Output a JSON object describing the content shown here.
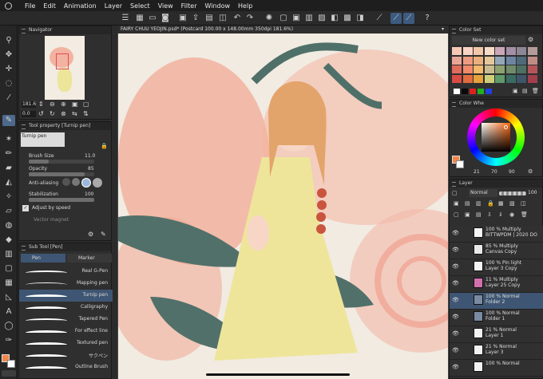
{
  "menu": [
    "File",
    "Edit",
    "Animation",
    "Layer",
    "Select",
    "View",
    "Filter",
    "Window",
    "Help"
  ],
  "document": {
    "tab": "FAIRY CHUU YEOJIN.psd* (Postcard 100.00 x 148.00mm 350dpi 181.6%)"
  },
  "navigator": {
    "title": "Navigator",
    "zoom": "181.6",
    "angle": "0.0"
  },
  "tool_property": {
    "title": "Tool property [Turnip pen]",
    "tool_name": "Turnip pen",
    "brush_size_label": "Brush Size",
    "brush_size": "11.0",
    "opacity_label": "Opacity",
    "opacity": "85",
    "aa_label": "Anti-aliasing",
    "stabilization_label": "Stabilization",
    "stabilization": "100",
    "adjust_label": "Adjust by speed",
    "vector_label": "Vector magnet"
  },
  "sub_tool": {
    "title": "Sub Tool [Pen]",
    "tabs": [
      "Pen",
      "Marker"
    ],
    "items": [
      "Real G-Pen",
      "Mapping pen",
      "Turnip pen",
      "Calligraphy",
      "Tapered Pen",
      "For effect line",
      "Textured pen",
      "サクペン",
      "Outline Brush"
    ]
  },
  "color_set": {
    "title": "Color Set",
    "dropdown": "New color set",
    "swatches": [
      "#f6c9b4",
      "#f8d4c4",
      "#f2c6a8",
      "#f6dcc8",
      "#c9a7b7",
      "#a48fa6",
      "#8c8696",
      "#b39c9a",
      "#e9a695",
      "#ed9b80",
      "#e9b07e",
      "#e6c79b",
      "#94a7b9",
      "#6d85a3",
      "#4f6a7b",
      "#c08d86",
      "#e26b5b",
      "#f08a6a",
      "#f4b86a",
      "#cbbb90",
      "#8ca16f",
      "#6f8c6a",
      "#4d7062",
      "#b6545b",
      "#d94b44",
      "#e16c3d",
      "#e7a23d",
      "#cfcf7a",
      "#5e9a6a",
      "#3a6c63",
      "#3f5569",
      "#a23f4c"
    ],
    "primaries": [
      "#ffffff",
      "#0a0a0a",
      "#e02020",
      "#20b020",
      "#2040e0"
    ]
  },
  "color_wheel": {
    "title": "Color Whe",
    "h": "21",
    "s": "70",
    "v": "90",
    "main": "#f0864a",
    "sub": "#ffffff"
  },
  "layer": {
    "title": "Layer",
    "blend": "Normal",
    "opacity": "100",
    "rows": [
      {
        "l1": "100 % Multiply",
        "l2": "BITTWPDM | 2020 DO",
        "thumb": "#f4f4f4",
        "sel": false
      },
      {
        "l1": "85 % Multiply",
        "l2": "Canvas Copy",
        "thumb": "#e9e9e9",
        "sel": false
      },
      {
        "l1": "100 % Pin light",
        "l2": "Layer 3 Copy",
        "thumb": "#f5f5f5",
        "sel": false
      },
      {
        "l1": "11 % Multiply",
        "l2": "Layer 25 Copy",
        "thumb": "#d46fae",
        "sel": false
      },
      {
        "l1": "100 % Normal",
        "l2": "Folder 2",
        "thumb": "#7a8aa0",
        "sel": true
      },
      {
        "l1": "100 % Normal",
        "l2": "Folder 1",
        "thumb": "#7a8aa0",
        "sel": false
      },
      {
        "l1": "21 % Normal",
        "l2": "Layer 1",
        "thumb": "#f2f2f2",
        "sel": false
      },
      {
        "l1": "21 % Normal",
        "l2": "Layer 3",
        "thumb": "#f2f2f2",
        "sel": false
      },
      {
        "l1": "100 % Normal",
        "l2": "",
        "thumb": "#f2f2f2",
        "sel": false
      }
    ]
  }
}
